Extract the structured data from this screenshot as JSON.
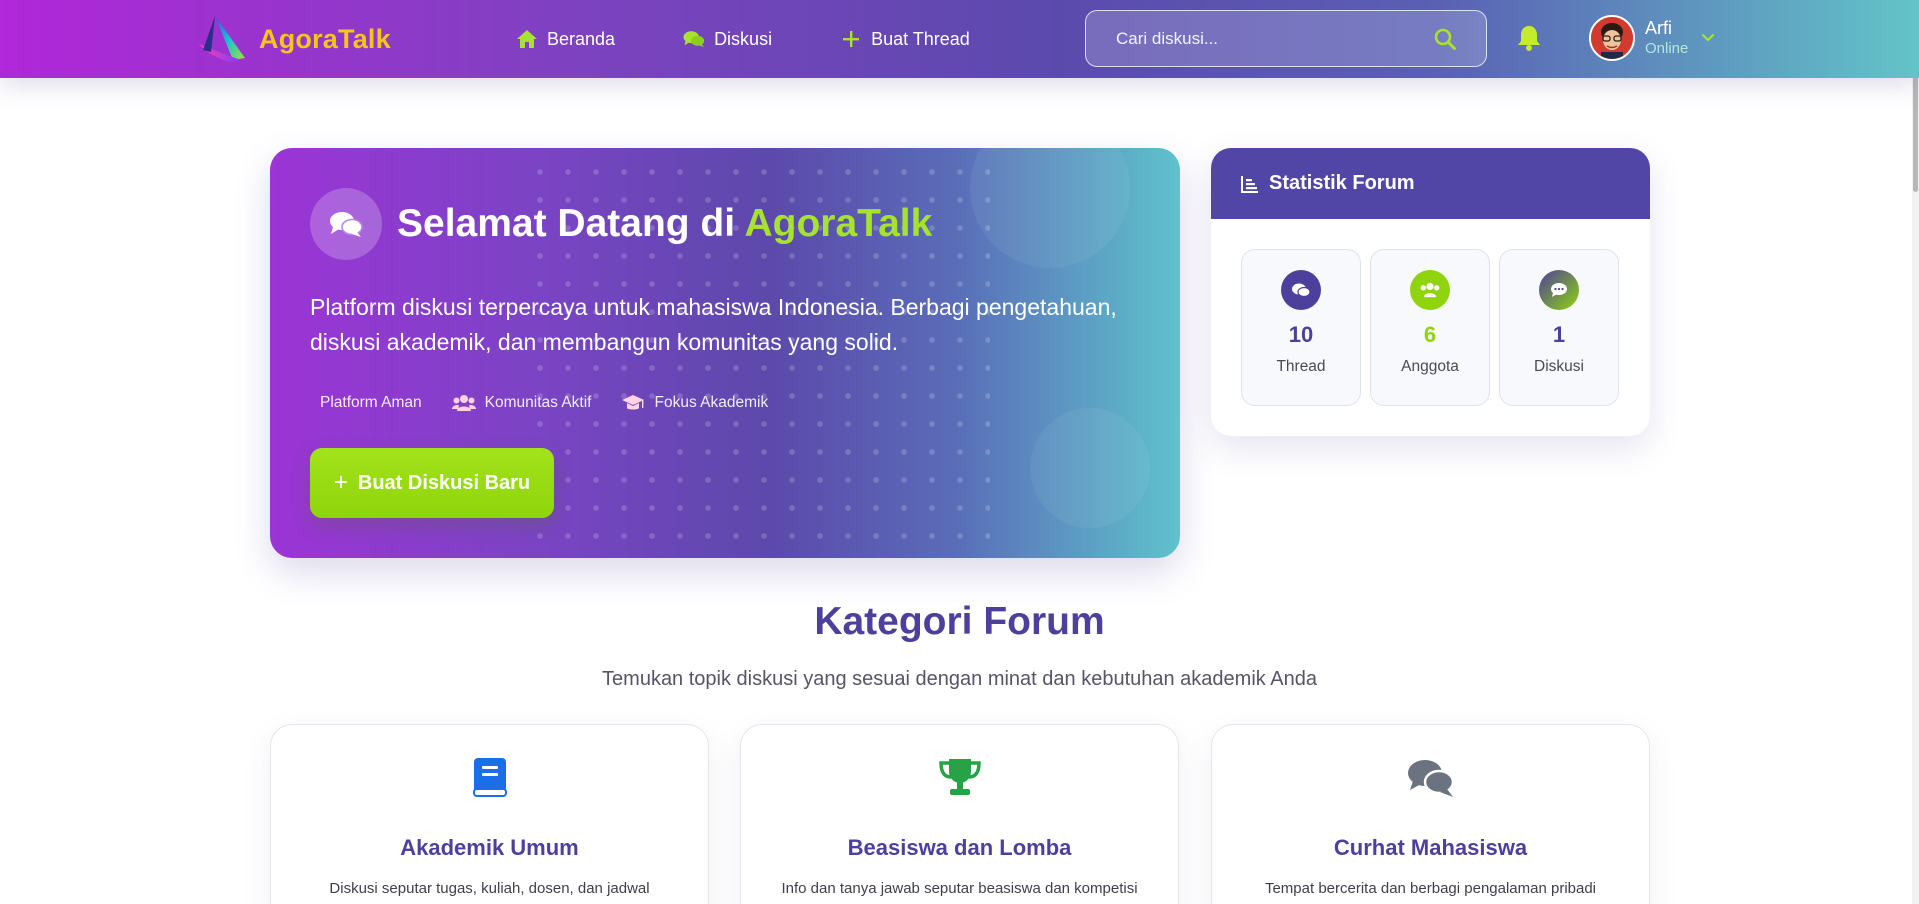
{
  "brand": {
    "name": "AgoraTalk"
  },
  "nav": {
    "links": [
      {
        "label": "Beranda",
        "icon": "home-icon"
      },
      {
        "label": "Diskusi",
        "icon": "comments-icon"
      },
      {
        "label": "Buat Thread",
        "icon": "plus-icon"
      }
    ]
  },
  "search": {
    "placeholder": "Cari diskusi...",
    "value": ""
  },
  "user": {
    "name": "Arfi",
    "status": "Online"
  },
  "hero": {
    "title_prefix": "Selamat Datang di",
    "title_accent": "AgoraTalk",
    "description": "Platform diskusi terpercaya untuk mahasiswa Indonesia. Berbagi pengetahuan, diskusi akademik, dan membangun komunitas yang solid.",
    "features": [
      {
        "label": "Platform Aman",
        "icon": ""
      },
      {
        "label": "Komunitas Aktif",
        "icon": "users-icon"
      },
      {
        "label": "Fokus Akademik",
        "icon": "graduation-cap-icon"
      }
    ],
    "cta_label": "Buat Diskusi Baru"
  },
  "stats": {
    "title": "Statistik Forum",
    "items": [
      {
        "value": "10",
        "label": "Thread",
        "icon": "comments-icon",
        "color": "#4d3f9c"
      },
      {
        "value": "6",
        "label": "Anggota",
        "icon": "users-icon",
        "color": "#8fd40c"
      },
      {
        "value": "1",
        "label": "Diskusi",
        "icon": "comment-dots-icon",
        "color": "#4d3f9c"
      }
    ]
  },
  "categories": {
    "title": "Kategori Forum",
    "subtitle": "Temukan topik diskusi yang sesuai dengan minat dan kebutuhan akademik Anda",
    "items": [
      {
        "name": "Akademik Umum",
        "description": "Diskusi seputar tugas, kuliah, dosen, dan jadwal",
        "icon": "book-icon",
        "color": "#1a6ee8"
      },
      {
        "name": "Beasiswa dan Lomba",
        "description": "Info dan tanya jawab seputar beasiswa dan kompetisi",
        "icon": "trophy-icon",
        "color": "#27a244"
      },
      {
        "name": "Curhat Mahasiswa",
        "description": "Tempat bercerita dan berbagi pengalaman pribadi",
        "icon": "comments-icon",
        "color": "#6b7280"
      }
    ]
  },
  "colors": {
    "primary": "#5146a6",
    "accent_green": "#8fd40c",
    "brand_yellow": "#f5c518"
  }
}
